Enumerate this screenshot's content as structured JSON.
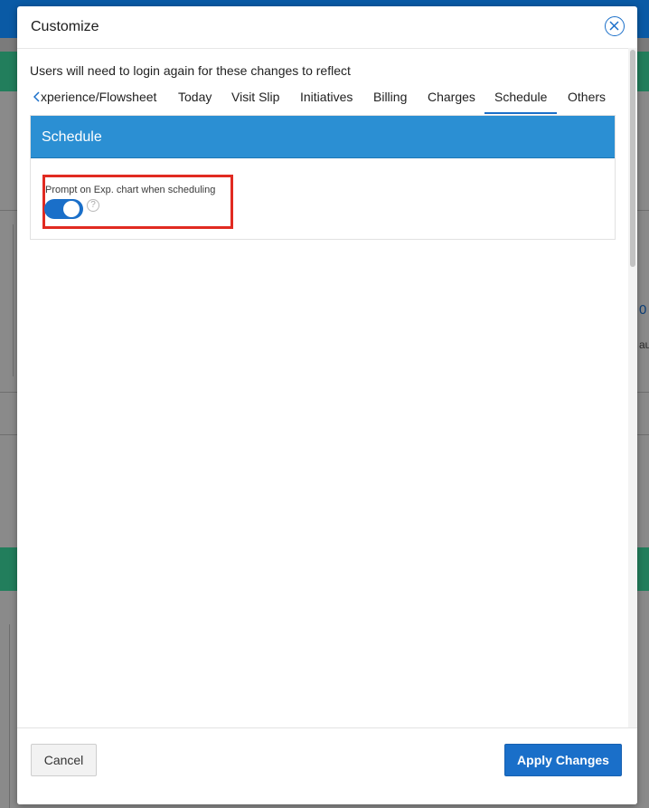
{
  "dialog": {
    "title": "Customize",
    "notice": "Users will need to login again for these changes to reflect"
  },
  "tabs": [
    {
      "label": "xperience/Flowsheet"
    },
    {
      "label": "Today"
    },
    {
      "label": "Visit Slip"
    },
    {
      "label": "Initiatives"
    },
    {
      "label": "Billing"
    },
    {
      "label": "Charges"
    },
    {
      "label": "Schedule",
      "active": true
    },
    {
      "label": "Others"
    }
  ],
  "panel": {
    "title": "Schedule",
    "setting_label": "Prompt on Exp. chart when scheduling",
    "toggle_on": true,
    "help_symbol": "?"
  },
  "footer": {
    "cancel_label": "Cancel",
    "apply_label": "Apply Changes"
  },
  "background": {
    "peek_text_1": "0",
    "peek_text_2": "au"
  },
  "icons": {
    "close": "close-icon",
    "prev": "chevron-left-icon",
    "help": "help-icon"
  },
  "colors": {
    "accent": "#1a6fc9",
    "panel_header": "#2b8fd3",
    "highlight": "#e12a21",
    "green_bar": "#227e5c",
    "top_bar": "#0a5aa5"
  }
}
